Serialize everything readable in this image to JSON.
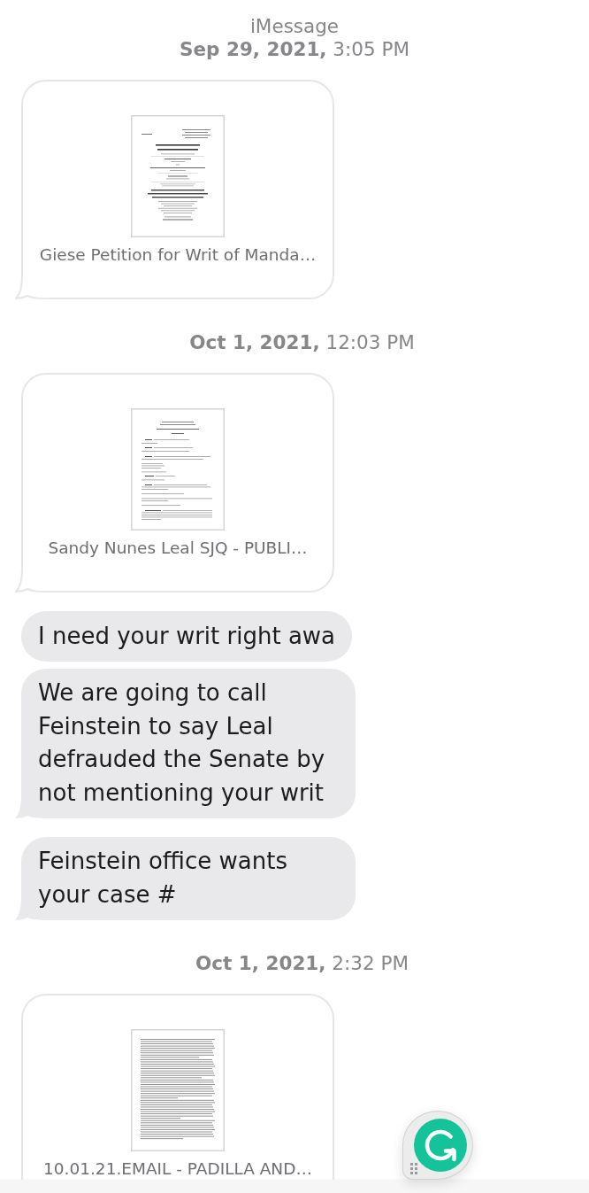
{
  "header": {
    "service": "iMessage",
    "timestamp": "**Sep 29, 2021,** 3:05 PM"
  },
  "items": [
    {
      "kind": "attachment",
      "preview": {
        "kind": "title_page"
      },
      "filename": "Giese Petition for Writ of Manda…",
      "tail": true
    },
    {
      "kind": "timestamp",
      "text": "**Oct 1, 2021,** 12:03 PM"
    },
    {
      "kind": "attachment",
      "preview": {
        "kind": "form"
      },
      "filename": "Sandy Nunes Leal SJQ - PUBLI…",
      "tail": true
    },
    {
      "kind": "message",
      "text": "I need your writ right awa",
      "tail": false
    },
    {
      "kind": "message",
      "text": "We are going to call Feinstein to say Leal defrauded the Senate by not mentioning your writ",
      "tail": true
    },
    {
      "kind": "message",
      "text": "Feinstein office wants your case #",
      "tail": true
    },
    {
      "kind": "timestamp",
      "text": "**Oct 1, 2021,** 2:32 PM"
    },
    {
      "kind": "attachment",
      "preview": {
        "kind": "text_page"
      },
      "filename": "10.01.21.EMAIL - PADILLA AND…",
      "tail": false
    }
  ]
}
